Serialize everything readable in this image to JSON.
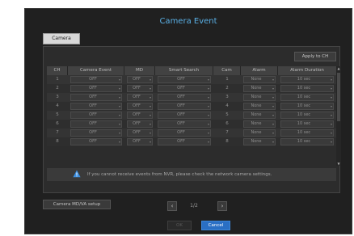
{
  "dialog": {
    "title": "Camera Event",
    "tab_camera": "Camera",
    "apply_to_ch": "Apply to CH",
    "accent": "#5ab0e6"
  },
  "table": {
    "headers": [
      "CH",
      "Camera Event",
      "MD",
      "Smart Search",
      "Cam",
      "Alarm",
      "Alarm Duration"
    ],
    "rows": [
      {
        "ch": "1",
        "event": "OFF",
        "md": "OFF",
        "search": "OFF",
        "cam": "1",
        "alarm": "None",
        "duration": "10 sec"
      },
      {
        "ch": "2",
        "event": "OFF",
        "md": "OFF",
        "search": "OFF",
        "cam": "2",
        "alarm": "None",
        "duration": "10 sec"
      },
      {
        "ch": "3",
        "event": "OFF",
        "md": "OFF",
        "search": "OFF",
        "cam": "3",
        "alarm": "None",
        "duration": "10 sec"
      },
      {
        "ch": "4",
        "event": "OFF",
        "md": "OFF",
        "search": "OFF",
        "cam": "4",
        "alarm": "None",
        "duration": "10 sec"
      },
      {
        "ch": "5",
        "event": "OFF",
        "md": "OFF",
        "search": "OFF",
        "cam": "5",
        "alarm": "None",
        "duration": "10 sec"
      },
      {
        "ch": "6",
        "event": "OFF",
        "md": "OFF",
        "search": "OFF",
        "cam": "6",
        "alarm": "None",
        "duration": "10 sec"
      },
      {
        "ch": "7",
        "event": "OFF",
        "md": "OFF",
        "search": "OFF",
        "cam": "7",
        "alarm": "None",
        "duration": "10 sec"
      },
      {
        "ch": "8",
        "event": "OFF",
        "md": "OFF",
        "search": "OFF",
        "cam": "8",
        "alarm": "None",
        "duration": "10 sec"
      }
    ]
  },
  "note": {
    "icon": "warning-icon",
    "text": "If you cannot receive events from NVR, please check the network camera settings."
  },
  "footer": {
    "setup_button": "Camera MD/VA setup",
    "prev_icon": "chevron-left-icon",
    "next_icon": "chevron-right-icon",
    "page": "1/2",
    "ok": "OK",
    "cancel": "Cancel",
    "cancel_color": "#2a6fc4"
  }
}
